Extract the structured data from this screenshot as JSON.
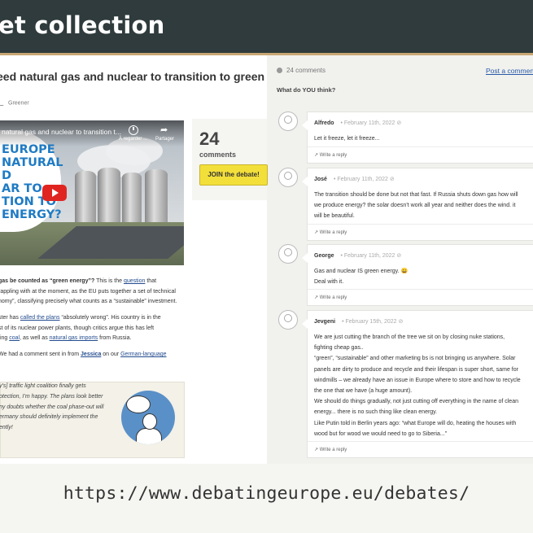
{
  "slide": {
    "title": "et collection",
    "url": "https://www.debatingeurope.eu/debates/"
  },
  "article": {
    "title": "eed natural gas and nuclear to transition to green",
    "tag": "Greener",
    "video": {
      "title": "natural gas and nuclear to transition t...",
      "watch_later": "À regarder ...",
      "share": "Partager",
      "overlay_lines": [
        "EUROPE",
        "NATURAL",
        "D",
        "AR TO",
        "TION TO",
        "ENERGY?"
      ]
    },
    "paragraphs": [
      {
        "parts": [
          {
            "t": "gas be counted as “green energy”?",
            "b": true
          },
          {
            "t": " This is the "
          },
          {
            "t": "question",
            "l": true
          },
          {
            "t": " that"
          }
        ]
      },
      {
        "parts": [
          {
            "t": "rappling with at the moment, as the EU puts together a set of technical"
          }
        ]
      },
      {
        "parts": [
          {
            "t": "nomy”, classifying precisely what counts as a “sustainable” investment."
          }
        ]
      },
      {
        "parts": [
          {
            "t": "ster has "
          },
          {
            "t": "called the plans",
            "l": true
          },
          {
            "t": " “absolutely wrong”. His country is in the"
          }
        ]
      },
      {
        "parts": [
          {
            "t": "st of its nuclear power plants, though critics argue this has left"
          }
        ]
      },
      {
        "parts": [
          {
            "t": "ting "
          },
          {
            "t": "coal",
            "l": true
          },
          {
            "t": ", as well as "
          },
          {
            "t": "natural gas imports",
            "l": true
          },
          {
            "t": " from Russia."
          }
        ]
      },
      {
        "parts": [
          {
            "t": "We had a comment sent in from "
          },
          {
            "t": "Jessica",
            "l": true,
            "b": true
          },
          {
            "t": " on our "
          },
          {
            "t": "German-language",
            "l": true
          }
        ]
      }
    ],
    "quote_lines": [
      "y's] traffic light coalition finally gets",
      "otection, I’m happy. The plans look better",
      "ny doubts whether the coal phase-out will",
      "ermany should definitely implement the",
      "ently!"
    ]
  },
  "counter": {
    "number": "24",
    "label": "comments",
    "join_label": "JOIN the debate!"
  },
  "comments_panel": {
    "count_label": "24 comments",
    "post_label": "Post a comment",
    "prompt": "What do YOU think?",
    "reply_label": "Write a reply",
    "comments": [
      {
        "author": "Alfredo",
        "date": "February 11th, 2022",
        "lines": [
          "Let it freeze, let it freeze..."
        ]
      },
      {
        "author": "José",
        "date": "February 11th, 2022",
        "lines": [
          "The transition should be done but not that fast. If Russia shuts down gas how will",
          "we produce energy? the solar doesn’t work all year and neither does the wind. it",
          "will be beautiful."
        ]
      },
      {
        "author": "George",
        "date": "February 11th, 2022",
        "lines": [
          "Gas and nuclear IS green energy. 😀",
          "Deal with it."
        ]
      },
      {
        "author": "Jevgeni",
        "date": "February 15th, 2022",
        "lines": [
          "We are just cutting the branch of the tree we sit on by closing nuke stations,",
          "fighting cheap gas..",
          "“green”, “sustainable” and other marketing bs is not bringing us anywhere. Solar",
          "panels are dirty to produce and recycle and their lifespan is super short, same for",
          "windmills – we already have an issue in Europe where to store and how to recycle",
          "the one that we have (a huge amount).",
          "We should do things gradually, not just cutting off everything in the name of clean",
          "energy... there is no such thing like clean energy.",
          "Like Putin told in Berlin years ago: “what Europe will do, heating the houses with",
          "wood but for wood we would need to go to Siberia...”"
        ]
      }
    ]
  }
}
